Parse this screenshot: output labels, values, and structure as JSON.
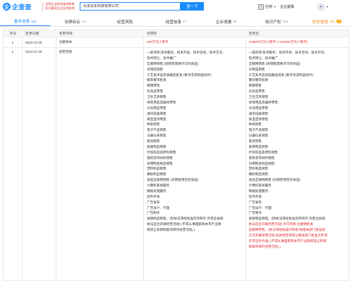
{
  "header": {
    "logo_text": "企查查",
    "slogan_line1": "全国企业信用查询系统",
    "slogan_line2": "官方备案企业征信机构",
    "search_value": "北京云车科技有限公司",
    "search_button": "查一下",
    "app_label": "应用",
    "enterprise_label": "企业套餐",
    "avatar_icon": "user-avatar-icon"
  },
  "tabs": [
    {
      "label": "基本信息",
      "count": "115"
    },
    {
      "label": "法律诉讼",
      "count": "117"
    },
    {
      "label": "经营风险",
      "count": ""
    },
    {
      "label": "经营信息",
      "count": "17"
    },
    {
      "label": "企业发展",
      "count": "65"
    },
    {
      "label": "知识产权",
      "count": "443"
    },
    {
      "label": "历史信息",
      "count": "120"
    }
  ],
  "table": {
    "headers": [
      "序号",
      "变更日期",
      "变更项目",
      "变更前",
      "变更后"
    ],
    "rows": [
      {
        "index": "1",
        "date": "2023-12-25",
        "item": "注册资本",
        "before": "500万元人民币",
        "after": "125500万元人民币 (+125000万元人民币)"
      },
      {
        "index": "2",
        "date": "2023-12-25",
        "item": "经营范围",
        "before_lines": [
          "一般项目:技术服务、技术开发、技术咨询、技术交流、",
          "技术转让、技术推广",
          "互联网销售 (除销售需要许可的商品)",
          "日用品销售",
          "工艺美术品及收藏品批发 (象牙及其制品除外)",
          "服装服饰批发",
          "鞋帽零售",
          "化妆品零售",
          "卫生洁具销售",
          "体育用品及器材零售",
          "文具用品零售",
          "通讯设备销售",
          "珠宝首饰零售",
          "钟表销售",
          "电子产品销售",
          "仪器仪表销售",
          "家具销售",
          "金属制品销售",
          "针纺织品及原料销售",
          "建筑装饰材料销售",
          "日用陶瓷制品销售",
          "塑料制品销售",
          "橡胶制品销售",
          "食品互联网销售 (仅销售预包装食品)",
          "计算机系统服务",
          "数据处理服务",
          "软件开发",
          "广告发布",
          "广告设计、代理",
          "广告制作",
          "金银制品销售。(除依法须经批准的项目外,凭营业执照",
          "依法自主开展经营活动) (不得从事国家和本市产业政",
          "策禁止和限制类项目的经营活动。)"
        ],
        "after_lines": [
          "一般项目:技术服务、技术开发、技术咨询、技术交流、",
          "技术转让、技术推广",
          "互联网销售 (除销售需要许可的商品)",
          "日用品销售",
          "工艺美术品及收藏品批发 (象牙及其制品除外)",
          "服装服饰批发",
          "鞋帽零售",
          "化妆品零售",
          "卫生洁具销售",
          "体育用品及器材零售",
          "文具用品零售",
          "通讯设备销售",
          "珠宝首饰零售",
          "钟表销售",
          "电子产品销售",
          "仪器仪表销售",
          "家具销售",
          "金属制品销售",
          "针纺织品及原料销售",
          "建筑装饰材料销售",
          "日用陶瓷制品销售",
          "塑料制品销售",
          "橡胶制品销售",
          "食品互联网销售 (仅销售预包装食品)",
          "计算机系统服务",
          "数据处理服务",
          "软件开发",
          "广告发布",
          "广告设计、代理",
          "广告制作",
          "金银制品销售。(除依法须经批准的项目外,凭营业执照",
          "依法自主开展经营活动) 许可项目:出版物批发",
          "出版物零售。(依法须经批准的项目,经相关部门批准后",
          "方可开展经营活动,具体经营项目以相关部门批准文件或",
          "许可证件为准) (不得从事国家和本市产业政策禁止和限",
          "制类项目的经营活动。)"
        ],
        "after_red_from": 31
      }
    ]
  },
  "colors": {
    "accent": "#1a8cff",
    "red": "#e0282e",
    "history": "#f08a24"
  }
}
